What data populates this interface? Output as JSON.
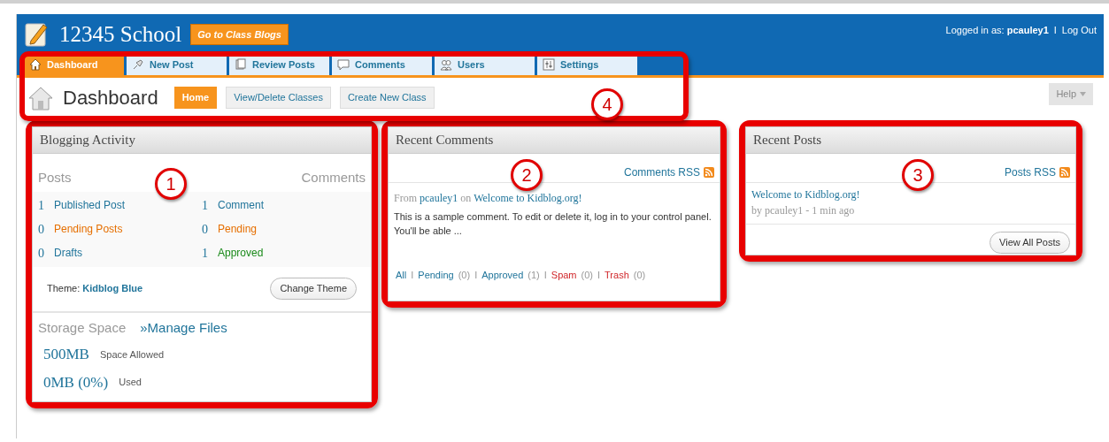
{
  "header": {
    "site_title": "12345 School",
    "class_blogs_button": "Go to Class Blogs",
    "logged_in_label": "Logged in as:",
    "username": "pcauley1",
    "separator": "I",
    "logout": "Log Out"
  },
  "tabs": [
    {
      "label": "Dashboard",
      "selected": true
    },
    {
      "label": "New Post",
      "selected": false
    },
    {
      "label": "Review Posts",
      "selected": false
    },
    {
      "label": "Comments",
      "selected": false
    },
    {
      "label": "Users",
      "selected": false
    },
    {
      "label": "Settings",
      "selected": false
    }
  ],
  "page_title": "Dashboard",
  "subtabs": [
    {
      "label": "Home",
      "selected": true
    },
    {
      "label": "View/Delete Classes",
      "selected": false
    },
    {
      "label": "Create New Class",
      "selected": false
    }
  ],
  "help_button": "Help",
  "blogging_activity": {
    "title": "Blogging Activity",
    "posts_heading": "Posts",
    "comments_heading": "Comments",
    "posts": [
      {
        "count": "1",
        "label": "Published Post",
        "kind": "normal"
      },
      {
        "count": "0",
        "label": "Pending Posts",
        "kind": "pending"
      },
      {
        "count": "0",
        "label": "Drafts",
        "kind": "normal"
      }
    ],
    "comments": [
      {
        "count": "1",
        "label": "Comment",
        "kind": "normal"
      },
      {
        "count": "0",
        "label": "Pending",
        "kind": "pending"
      },
      {
        "count": "1",
        "label": "Approved",
        "kind": "approved"
      }
    ],
    "theme_label": "Theme:",
    "theme_name": "Kidblog Blue",
    "change_theme_button": "Change Theme",
    "storage_heading": "Storage Space",
    "manage_files_link": "»Manage Files",
    "storage": [
      {
        "amount": "500MB",
        "label": "Space Allowed"
      },
      {
        "amount": "0MB (0%)",
        "label": "Used"
      }
    ]
  },
  "recent_comments": {
    "title": "Recent Comments",
    "rss_link": "Comments RSS",
    "from_label": "From",
    "author": "pcauley1",
    "on_label": "on",
    "post_link": "Welcome to Kidblog.org!",
    "excerpt": "This is a sample comment. To edit or delete it, log in to your control panel. You'll be able ...",
    "filters": [
      {
        "label": "All",
        "kind": "normal"
      },
      {
        "separator": "I",
        "label": "Pending",
        "count": "(0)",
        "kind": "normal"
      },
      {
        "separator": "I",
        "label": "Approved",
        "count": "(1)",
        "kind": "normal"
      },
      {
        "separator": "I",
        "label": "Spam",
        "count": "(0)",
        "kind": "danger"
      },
      {
        "separator": "I",
        "label": "Trash",
        "count": "(0)",
        "kind": "danger"
      }
    ]
  },
  "recent_posts": {
    "title": "Recent Posts",
    "rss_link": "Posts RSS",
    "post_link": "Welcome to Kidblog.org!",
    "byline": "by pcauley1 - 1 min ago",
    "view_all_button": "View All Posts"
  },
  "callouts": [
    "1",
    "2",
    "3",
    "4"
  ]
}
